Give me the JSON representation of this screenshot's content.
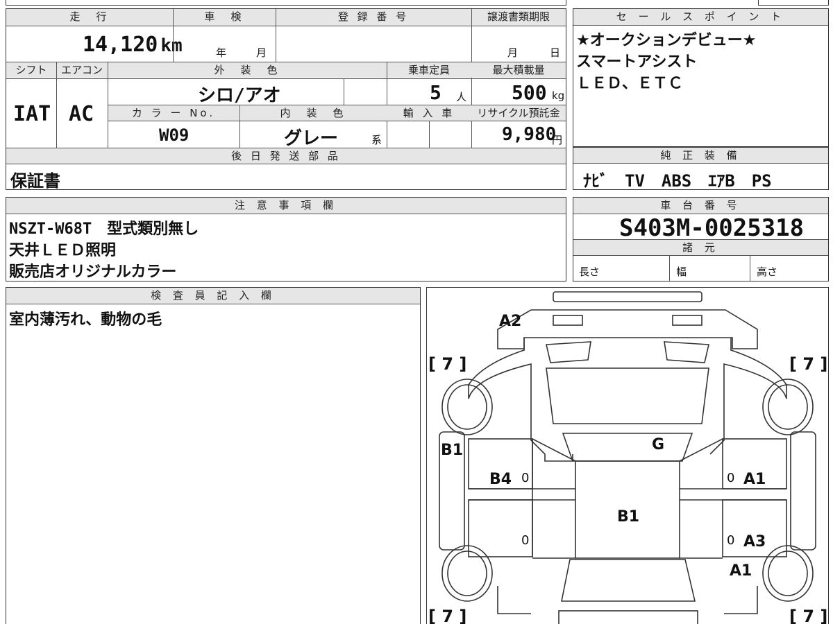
{
  "vehicle": {
    "mileage_label": "走　行",
    "mileage_value": "14,120",
    "mileage_unit": "km",
    "inspection_label": "車　検",
    "inspection_year": "年",
    "inspection_month": "月",
    "registration_label": "登 録 番 号",
    "transfer_deadline_label": "譲渡書類期限",
    "transfer_month": "月",
    "transfer_day": "日",
    "shift_label": "シフト",
    "shift_value": "IAT",
    "ac_label": "エアコン",
    "ac_value": "AC",
    "exterior_color_label": "外　装　色",
    "exterior_color_value": "シロ/アオ",
    "capacity_label": "乗車定員",
    "capacity_value": "5",
    "capacity_unit": "人",
    "max_load_label": "最大積載量",
    "max_load_value": "500",
    "max_load_unit": "kg",
    "color_no_label": "カ ラ ー No.",
    "color_no_value": "W09",
    "interior_color_label": "内　装　色",
    "interior_color_value": "グレー",
    "interior_suffix": "系",
    "import_label": "輸 入 車",
    "recycle_label": "リサイクル預託金",
    "recycle_value": "9,980",
    "recycle_unit": "円",
    "later_parts_label": "後 日 発 送 部 品",
    "later_parts_value": "保証書"
  },
  "sales_points": {
    "label": "セ ー ル ス ポ イ ン ト",
    "lines": [
      "★オークションデビュー★",
      "スマートアシスト",
      "ＬＥＤ、ＥＴＣ"
    ]
  },
  "equipment": {
    "label": "純 正 装 備",
    "value": "ﾅﾋﾞ　TV　ABS　ｴｱB　PS"
  },
  "notes": {
    "label": "注 意 事 項 欄",
    "lines": [
      "NSZT-W68T　型式類別無し",
      "天井ＬＥＤ照明",
      "販売店オリジナルカラー"
    ]
  },
  "chassis": {
    "label": "車 台 番 号",
    "value": "S403M-0025318",
    "spec_label": "諸 元",
    "length_label": "長さ",
    "width_label": "幅",
    "height_label": "高さ"
  },
  "inspector": {
    "label": "検 査 員 記 入 欄",
    "value": "室内薄汚れ、動物の毛"
  },
  "diagram": {
    "marks": {
      "a2": "A2",
      "tl7": "[ 7 ]",
      "tr7": "[ 7 ]",
      "bl7": "[ 7 ]",
      "br7": "[ 7 ]",
      "b1_left": "B1",
      "b4": "B4",
      "g": "G",
      "a1_right": "A1",
      "b1_center": "B1",
      "a3": "A3",
      "a1_lower": "A1",
      "zero_1": "0",
      "zero_2": "0",
      "zero_3": "0",
      "zero_4": "0"
    }
  }
}
